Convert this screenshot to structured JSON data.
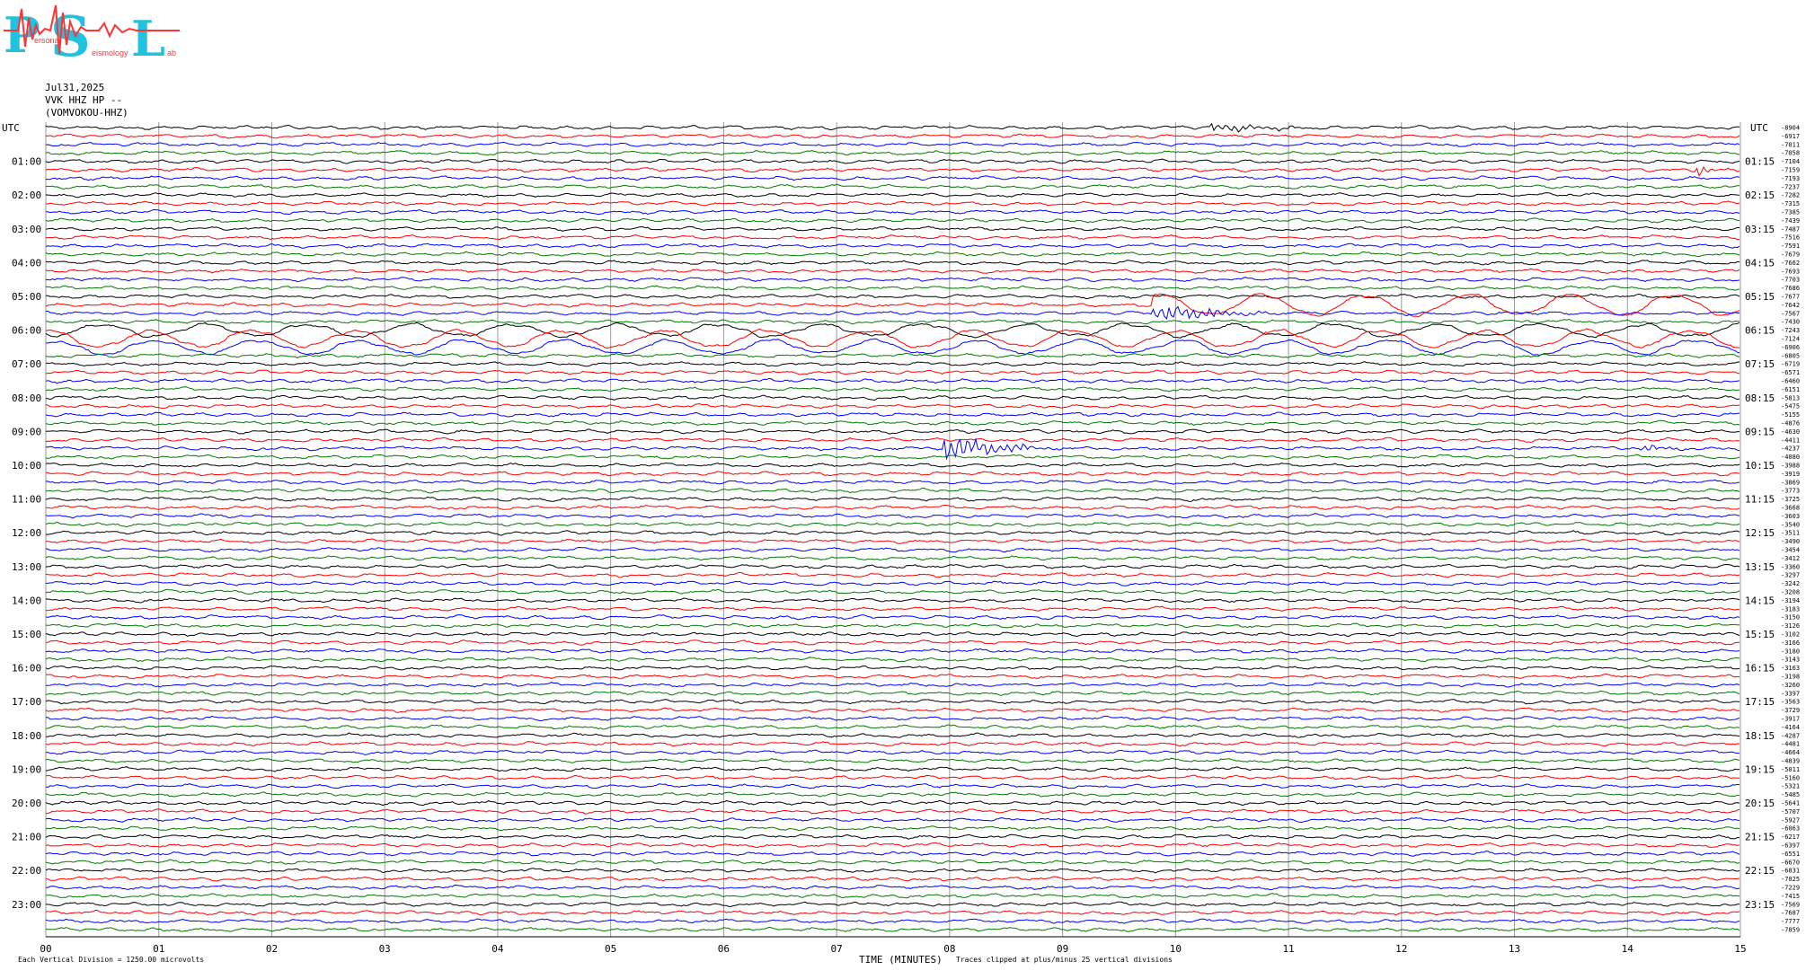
{
  "header": {
    "date": "Jul31,2025",
    "station": "VVK HHZ HP --",
    "channel": "(VOMVOKOU-HHZ)"
  },
  "logo": {
    "letters": [
      "P",
      "S",
      "L"
    ],
    "small_words": [
      "ersonal",
      "eismology",
      "ab"
    ],
    "colors": {
      "letters": "#22c1e0",
      "trace": "#ff3333"
    }
  },
  "footer": {
    "scale": "Each Vertical Division = 1250.00 microvolts",
    "xlabel": "TIME (MINUTES)",
    "clip": "Traces clipped at plus/minus 25 vertical divisions"
  },
  "trace_colors": [
    "#000000",
    "#ff0000",
    "#0000ff",
    "#007a00"
  ],
  "chart_data": {
    "type": "line",
    "xlabel": "TIME (MINUTES)",
    "xlim": [
      0,
      15
    ],
    "x_ticks": [
      "00",
      "01",
      "02",
      "03",
      "04",
      "05",
      "06",
      "07",
      "08",
      "09",
      "10",
      "11",
      "12",
      "13",
      "14",
      "15"
    ],
    "left_axis_label": "UTC",
    "right_axis_label": "UTC",
    "left_hour_labels": [
      "01:00",
      "02:00",
      "03:00",
      "04:00",
      "05:00",
      "06:00",
      "07:00",
      "08:00",
      "09:00",
      "10:00",
      "11:00",
      "12:00",
      "13:00",
      "14:00",
      "15:00",
      "16:00",
      "17:00",
      "18:00",
      "19:00",
      "20:00",
      "21:00",
      "22:00",
      "23:00"
    ],
    "right_hour_labels": [
      "01:15",
      "02:15",
      "03:15",
      "04:15",
      "05:15",
      "06:15",
      "07:15",
      "08:15",
      "09:15",
      "10:15",
      "11:15",
      "12:15",
      "13:15",
      "14:15",
      "15:15",
      "16:15",
      "17:15",
      "18:15",
      "19:15",
      "20:15",
      "21:15",
      "22:15",
      "23:15"
    ],
    "num_traces": 96,
    "minutes_per_trace": 15,
    "scale_microvolts_per_division": 1250,
    "trace_offsets": [
      -8904,
      -6917,
      -7011,
      -7058,
      -7104,
      -7159,
      -7193,
      -7237,
      -7282,
      -7315,
      -7385,
      -7439,
      -7487,
      -7516,
      -7591,
      -7679,
      -7662,
      -7693,
      -7703,
      -7686,
      -7677,
      -7642,
      -7567,
      -7430,
      -7243,
      -7124,
      -6906,
      -6805,
      -6719,
      -6571,
      -6460,
      -6151,
      -5813,
      -5475,
      -5155,
      -4876,
      -4630,
      -4411,
      -4237,
      -4080,
      -3988,
      -3919,
      -3869,
      -3773,
      -3725,
      -3668,
      -3603,
      -3540,
      -3511,
      -3490,
      -3454,
      -3412,
      -3360,
      -3297,
      -3242,
      -3208,
      -3194,
      -3183,
      -3150,
      -3126,
      -3102,
      -3166,
      -3180,
      -3143,
      -3163,
      -3198,
      -3260,
      -3397,
      -3563,
      -3729,
      -3917,
      -4164,
      -4287,
      -4481,
      -4664,
      -4839,
      -5011,
      -5160,
      -5321,
      -5485,
      -5641,
      -5707,
      -5927,
      -6063,
      -6217,
      -6397,
      -6551,
      -6670,
      -6831,
      -7025,
      -7229,
      -7415,
      -7569,
      -7687,
      -7777,
      -7859
    ],
    "events": [
      {
        "trace": 5,
        "start_min": 14.6,
        "end_min": 14.9,
        "amplitude": 1.8
      },
      {
        "trace": 21,
        "start_min": 9.8,
        "end_min": 15.0,
        "amplitude": 2.8
      },
      {
        "trace": 22,
        "start_min": 9.8,
        "end_min": 11.0,
        "amplitude": 3.0
      },
      {
        "trace": 24,
        "start_min": 0.0,
        "end_min": 15.0,
        "amplitude": 1.6
      },
      {
        "trace": 25,
        "start_min": 0.0,
        "end_min": 15.0,
        "amplitude": 2.2
      },
      {
        "trace": 26,
        "start_min": 0.0,
        "end_min": 15.0,
        "amplitude": 1.8
      },
      {
        "trace": 38,
        "start_min": 7.95,
        "end_min": 9.0,
        "amplitude": 4.2
      },
      {
        "trace": 38,
        "start_min": 14.1,
        "end_min": 14.7,
        "amplitude": 1.0
      },
      {
        "trace": 0,
        "start_min": 10.3,
        "end_min": 11.3,
        "amplitude": 1.4
      }
    ]
  }
}
